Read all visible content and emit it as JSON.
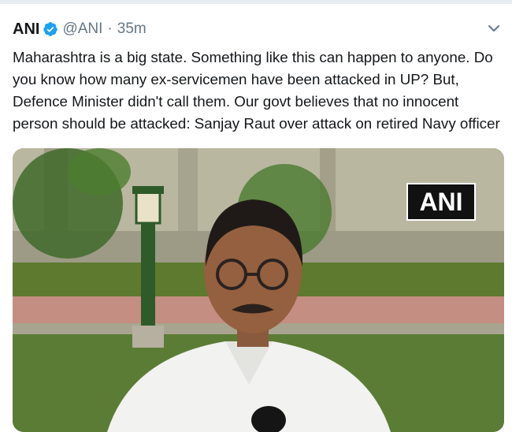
{
  "tweet": {
    "author_name": "ANI",
    "handle": "@ANI",
    "separator": "·",
    "time": "35m",
    "text": "Maharashtra is a big state. Something like this can happen to anyone. Do you know how many ex-servicemen have been attacked in UP? But, Defence Minister didn't call them. Our govt believes that no innocent person should be attacked: Sanjay Raut over attack on retired Navy officer",
    "media": {
      "watermark": "ANI"
    }
  },
  "icons": {
    "verified": "verified-badge-icon",
    "menu": "chevron-down-icon"
  },
  "colors": {
    "text": "#14171a",
    "secondary": "#657786",
    "verified_blue": "#1da1f2"
  }
}
